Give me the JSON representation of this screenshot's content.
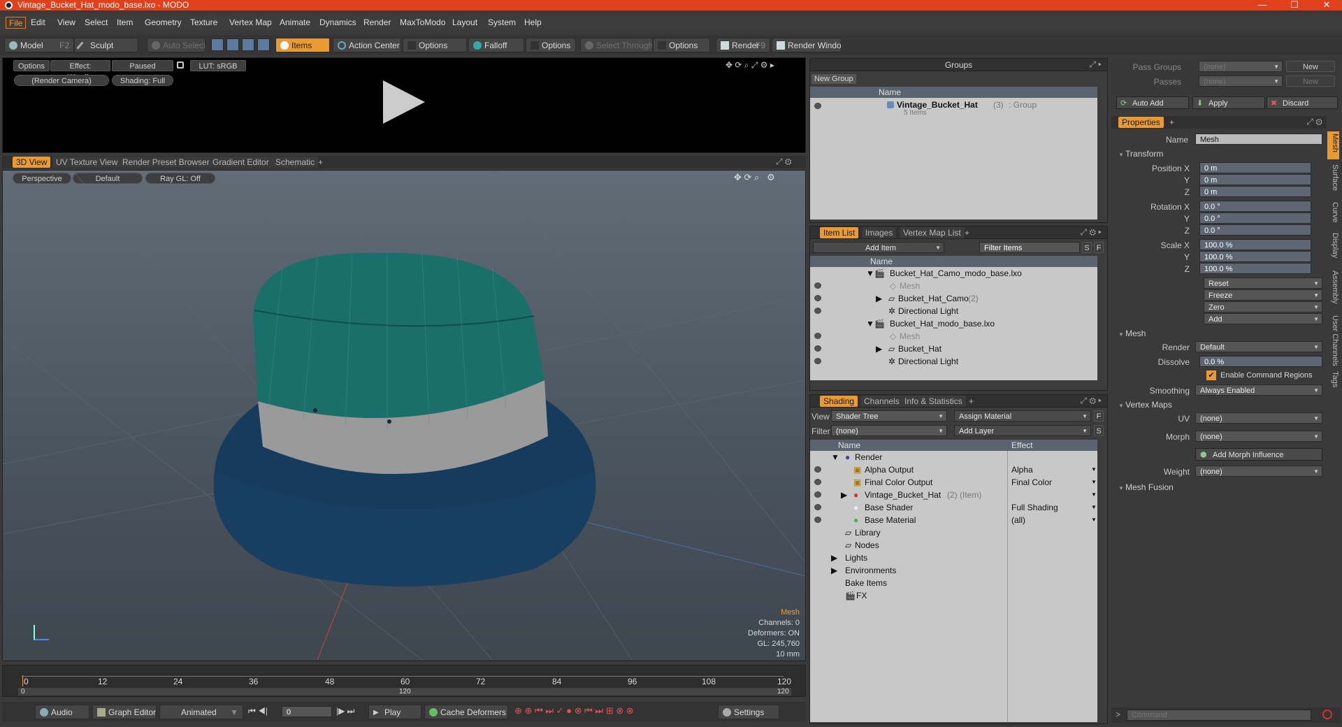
{
  "window": {
    "title": "Vintage_Bucket_Hat_modo_base.lxo - MODO",
    "minimize": "—",
    "maximize": "☐",
    "close": "✕"
  },
  "menu": [
    "File",
    "Edit",
    "View",
    "Select",
    "Item",
    "Geometry",
    "Texture",
    "Vertex Map",
    "Animate",
    "Dynamics",
    "Render",
    "MaxToModo",
    "Layout",
    "System",
    "Help"
  ],
  "toolbar": {
    "model": "Model",
    "model_key": "F2",
    "sculpt": "Sculpt",
    "auto_select": "Auto Select",
    "items": "Items",
    "action_center": "Action Center",
    "options1": "Options",
    "falloff": "Falloff",
    "options2": "Options",
    "select_through": "Select Through",
    "options3": "Options",
    "render": "Render",
    "render_key": "F9",
    "render_window": "Render Window"
  },
  "preview": {
    "options": "Options",
    "effect": "Effect: (Shadi...",
    "paused": "Paused",
    "lut": "LUT: sRGB",
    "camera": "(Render Camera)",
    "shading": "Shading: Full"
  },
  "viewport": {
    "tabs": [
      "3D View",
      "UV Texture View",
      "Render Preset Browser",
      "Gradient Editor",
      "Schematic"
    ],
    "tab_add": "+",
    "perspective": "Perspective",
    "default": "Default",
    "raygl": "Ray GL: Off",
    "info_title": "Mesh",
    "channels": "Channels: 0",
    "deformers": "Deformers: ON",
    "gl": "GL: 245,760",
    "scale": "10 mm"
  },
  "timeline": {
    "ticks": [
      "0",
      "12",
      "24",
      "36",
      "48",
      "60",
      "72",
      "84",
      "96",
      "108",
      "120"
    ],
    "range_start": "0",
    "range_mid": "120",
    "range_end": "120"
  },
  "bottombar": {
    "audio": "Audio",
    "graph_editor": "Graph Editor",
    "animated": "Animated",
    "frame": "0",
    "play": "Play",
    "cache": "Cache Deformers",
    "settings": "Settings"
  },
  "groups": {
    "title": "Groups",
    "new_group": "New Group",
    "col_name": "Name",
    "item_name": "Vintage_Bucket_Hat",
    "item_count": "(3)",
    "item_type": ": Group",
    "item_sub": "5 Items"
  },
  "itemlist": {
    "tabs": [
      "Item List",
      "Images",
      "Vertex Map List"
    ],
    "tab_add": "+",
    "add_item": "Add Item",
    "filter": "Filter Items",
    "s": "S",
    "f": "F",
    "col_name": "Name",
    "rows": [
      "Bucket_Hat_Camo_modo_base.lxo",
      "Mesh",
      "Bucket_Hat_Camo",
      "Directional Light",
      "Bucket_Hat_modo_base.lxo",
      "Mesh",
      "Bucket_Hat",
      "Directional Light"
    ],
    "camo_count": "(2)"
  },
  "shading": {
    "tabs": [
      "Shading",
      "Channels",
      "Info & Statistics"
    ],
    "tab_add": "+",
    "view_label": "View",
    "view_val": "Shader Tree",
    "assign": "Assign Material",
    "f": "F",
    "filter_label": "Filter",
    "filter_val": "(none)",
    "add_layer": "Add Layer",
    "s": "S",
    "col_name": "Name",
    "col_effect": "Effect",
    "rows": [
      {
        "name": "Render",
        "effect": ""
      },
      {
        "name": "Alpha Output",
        "effect": "Alpha"
      },
      {
        "name": "Final Color Output",
        "effect": "Final Color"
      },
      {
        "name": "Vintage_Bucket_Hat",
        "effect": ""
      },
      {
        "name": "Base Shader",
        "effect": "Full Shading"
      },
      {
        "name": "Base Material",
        "effect": "(all)"
      },
      {
        "name": "Library",
        "effect": ""
      },
      {
        "name": "Nodes",
        "effect": ""
      },
      {
        "name": "Lights",
        "effect": ""
      },
      {
        "name": "Environments",
        "effect": ""
      },
      {
        "name": "Bake Items",
        "effect": ""
      },
      {
        "name": "FX",
        "effect": ""
      }
    ],
    "hat_suffix": "(2) (Item)"
  },
  "passes": {
    "pass_groups": "Pass Groups",
    "passes": "Passes",
    "none1": "(none)",
    "none2": "(none)",
    "new1": "New",
    "new2": "New",
    "auto_add": "Auto Add",
    "apply": "Apply",
    "discard": "Discard"
  },
  "properties": {
    "tab": "Properties",
    "tab_add": "+",
    "name_label": "Name",
    "name_val": "Mesh",
    "transform": "Transform",
    "posx_l": "Position X",
    "posx": "0 m",
    "posy_l": "Y",
    "posy": "0 m",
    "posz_l": "Z",
    "posz": "0 m",
    "rotx_l": "Rotation X",
    "rotx": "0.0 °",
    "roty_l": "Y",
    "roty": "0.0 °",
    "rotz_l": "Z",
    "rotz": "0.0 °",
    "sclx_l": "Scale X",
    "sclx": "100.0 %",
    "scly_l": "Y",
    "scly": "100.0 %",
    "sclz_l": "Z",
    "sclz": "100.0 %",
    "reset": "Reset",
    "freeze": "Freeze",
    "zero": "Zero",
    "add": "Add",
    "mesh": "Mesh",
    "render_l": "Render",
    "render_v": "Default",
    "dissolve_l": "Dissolve",
    "dissolve_v": "0.0 %",
    "cmd_regions": "Enable Command Regions",
    "smoothing_l": "Smoothing",
    "smoothing_v": "Always Enabled",
    "vertex_maps": "Vertex Maps",
    "uv_l": "UV",
    "uv_v": "(none)",
    "morph_l": "Morph",
    "morph_v": "(none)",
    "add_morph": "Add Morph Influence",
    "weight_l": "Weight",
    "weight_v": "(none)",
    "mesh_fusion": "Mesh Fusion",
    "side_tabs": [
      "Mesh",
      "Surface",
      "Curve",
      "Display",
      "Assembly",
      "User Channels",
      "Tags"
    ],
    "command_placeholder": "Command"
  },
  "colors": {
    "accent": "#e99a33",
    "titlebar": "#e0401c",
    "hat_top": "#1a6f6b",
    "hat_band": "#8e8e8e",
    "hat_brim": "#183f62"
  }
}
